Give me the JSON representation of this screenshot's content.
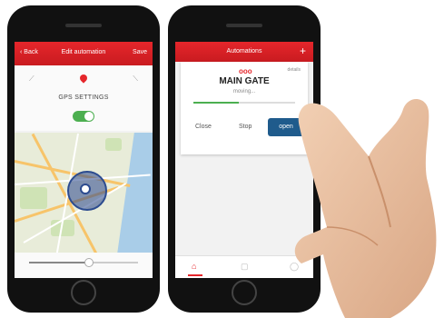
{
  "left_screen": {
    "header": {
      "back_label": "‹ Back",
      "title": "Edit automation",
      "save_label": "Save"
    },
    "gps_settings_label": "GPS SETTINGS",
    "gps_toggle": {
      "on": true,
      "color": "#4caf50"
    },
    "radius_slider": {
      "level": 0.55
    }
  },
  "right_screen": {
    "header": {
      "title": "Automations",
      "add_label": "+"
    },
    "gate_card": {
      "icon_label": "ooo",
      "detail_label": "details",
      "name": "MAIN GATE",
      "status": "moving...",
      "progress": 0.45,
      "buttons": {
        "close": "Close",
        "stop": "Stop",
        "open": "open"
      }
    },
    "tabs": [
      "home-icon",
      "cube-icon",
      "person-icon"
    ]
  },
  "colors": {
    "brand_red": "#e5262b",
    "accent_blue": "#1f5b8c",
    "toggle_green": "#4caf50"
  }
}
